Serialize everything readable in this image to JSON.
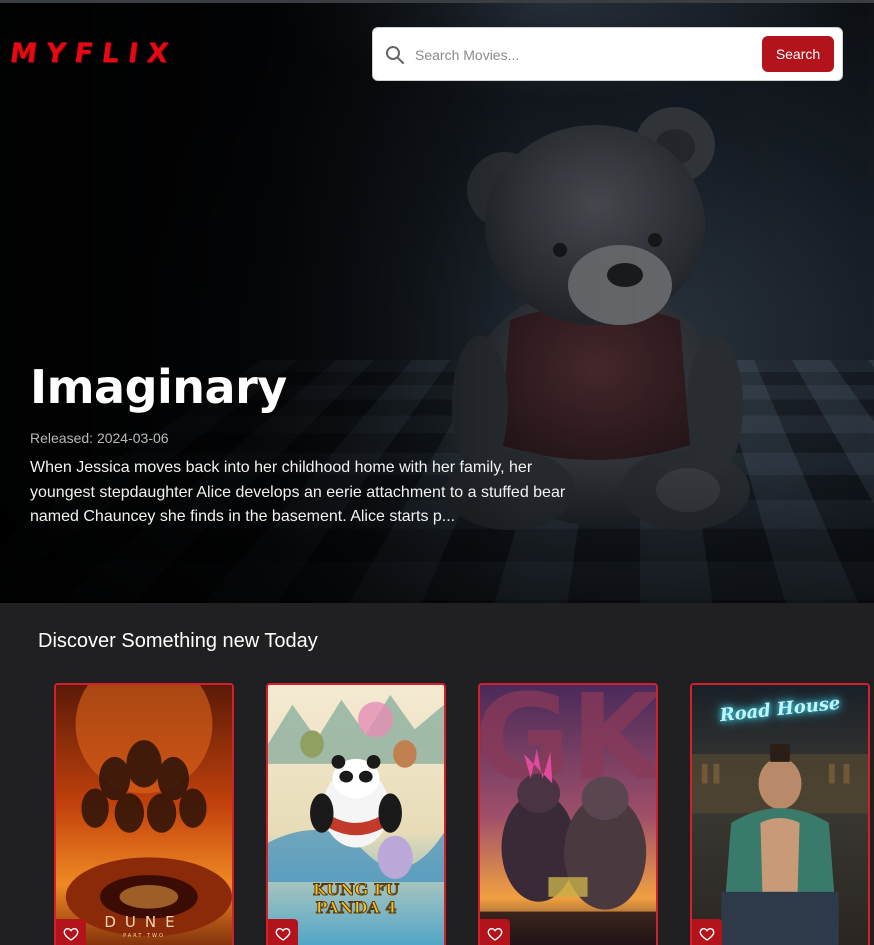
{
  "app": {
    "logo": "MYFLIX"
  },
  "search": {
    "placeholder": "Search Movies...",
    "button_label": "Search"
  },
  "hero": {
    "title": "Imaginary",
    "release_label": "Released:",
    "release_date": "2024-03-06",
    "overview": "When Jessica moves back into her childhood home with her family, her youngest stepdaughter Alice develops an eerie attachment to a stuffed bear named Chauncey she finds in the basement. Alice starts p..."
  },
  "discover": {
    "title": "Discover Something new Today",
    "movies": [
      {
        "poster_text": "DUNE",
        "poster_subtext": "PART TWO",
        "accent": "#e8641c"
      },
      {
        "poster_text": "KUNG FU PANDA 4",
        "accent": "#f2c230"
      },
      {
        "poster_text": "GK",
        "accent": "#c8365a"
      },
      {
        "poster_text": "Road House",
        "accent": "#3fd6f0"
      }
    ]
  },
  "colors": {
    "brand": "#e50914",
    "button": "#b3141c",
    "card_border": "#d3202a",
    "background": "#202022"
  }
}
